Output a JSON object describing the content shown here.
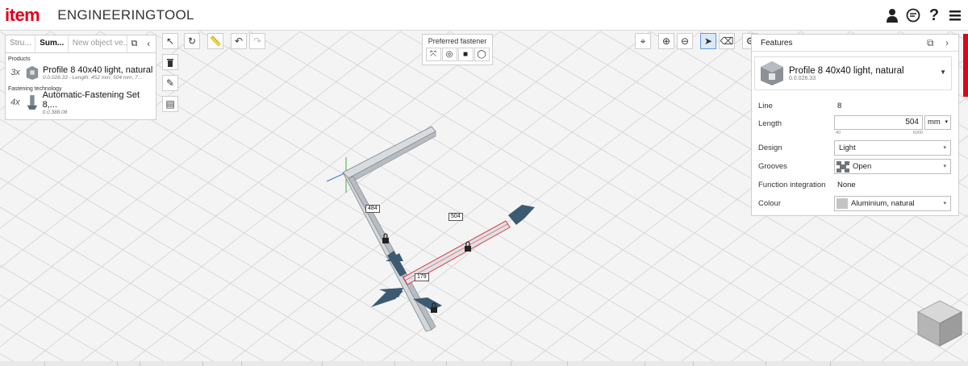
{
  "header": {
    "logo": "item",
    "app_title": "ENGINEERINGTOOL",
    "icons": [
      "user-icon",
      "chat-icon",
      "help-icon",
      "menu-icon"
    ]
  },
  "left_panel": {
    "tabs": [
      "Stru...",
      "Sum...",
      "New object ve..."
    ],
    "products_label": "Products",
    "products": [
      {
        "qty": "3x",
        "name": "Profile 8 40x40 light, natural",
        "sub": "0.0.026.33 - Length: 452 mm; 504 mm; 7..."
      }
    ],
    "fastening_label": "Fastening technology",
    "fastening": [
      {
        "qty": "4x",
        "name": "Automatic-Fastening Set 8,...",
        "sub": "0.0.388.08"
      }
    ]
  },
  "preferred_fastener": {
    "label": "Preferred fastener"
  },
  "dimensions": {
    "a": "484",
    "b": "504",
    "c": "179"
  },
  "features": {
    "title": "Features",
    "product_name": "Profile 8 40x40 light, natural",
    "product_id": "0.0.026.33",
    "line_label": "Line",
    "line_value": "8",
    "length_label": "Length",
    "length_value": "504",
    "length_unit": "mm",
    "length_min": "40",
    "length_max": "6000",
    "design_label": "Design",
    "design_value": "Light",
    "grooves_label": "Grooves",
    "grooves_value": "Open",
    "function_label": "Function integration",
    "function_value": "None",
    "colour_label": "Colour",
    "colour_value": "Aluminium, natural"
  },
  "colors": {
    "brand": "#e2001a",
    "arrow": "#3d5a73",
    "profile": "#c8ccd0"
  }
}
